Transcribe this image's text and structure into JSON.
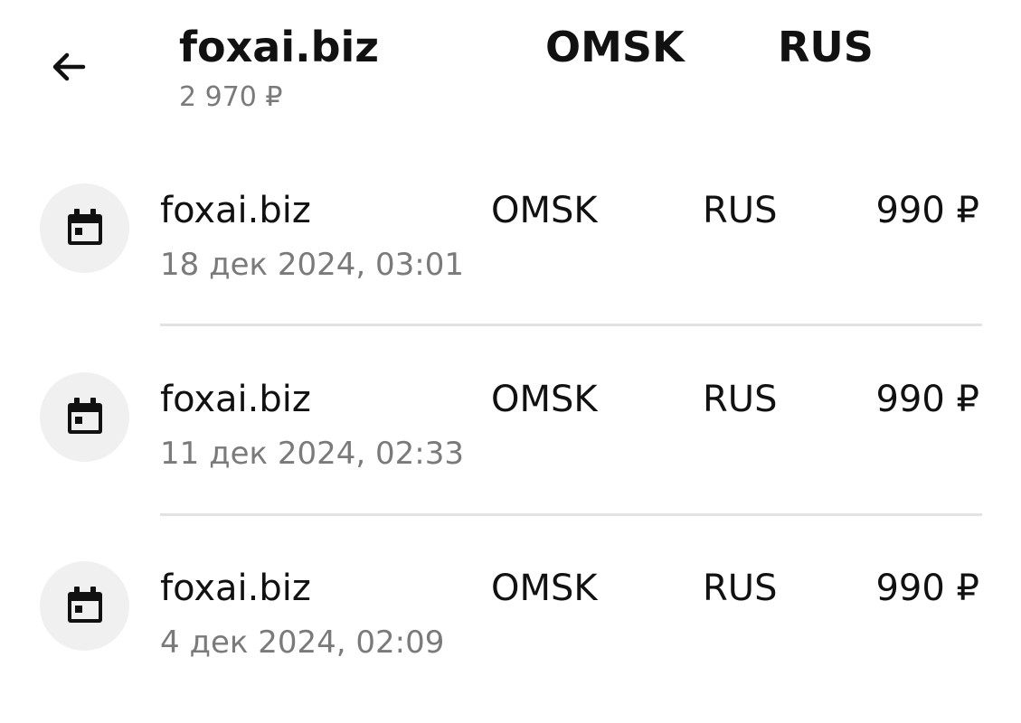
{
  "header": {
    "back_icon": "arrow-left-icon",
    "merchant": "foxai.biz",
    "city": "OMSK",
    "country": "RUS",
    "total": "2 970 ₽"
  },
  "transactions": [
    {
      "icon": "calendar-icon",
      "merchant": "foxai.biz",
      "city": "OMSK",
      "country": "RUS",
      "amount": "990 ₽",
      "date": "18 дек 2024, 03:01"
    },
    {
      "icon": "calendar-icon",
      "merchant": "foxai.biz",
      "city": "OMSK",
      "country": "RUS",
      "amount": "990 ₽",
      "date": "11 дек 2024, 02:33"
    },
    {
      "icon": "calendar-icon",
      "merchant": "foxai.biz",
      "city": "OMSK",
      "country": "RUS",
      "amount": "990 ₽",
      "date": "4 дек 2024, 02:09"
    }
  ],
  "colors": {
    "text_primary": "#111111",
    "text_secondary": "#7a7a7a",
    "icon_background": "#f0f0f0",
    "divider": "#e2e2e2"
  }
}
